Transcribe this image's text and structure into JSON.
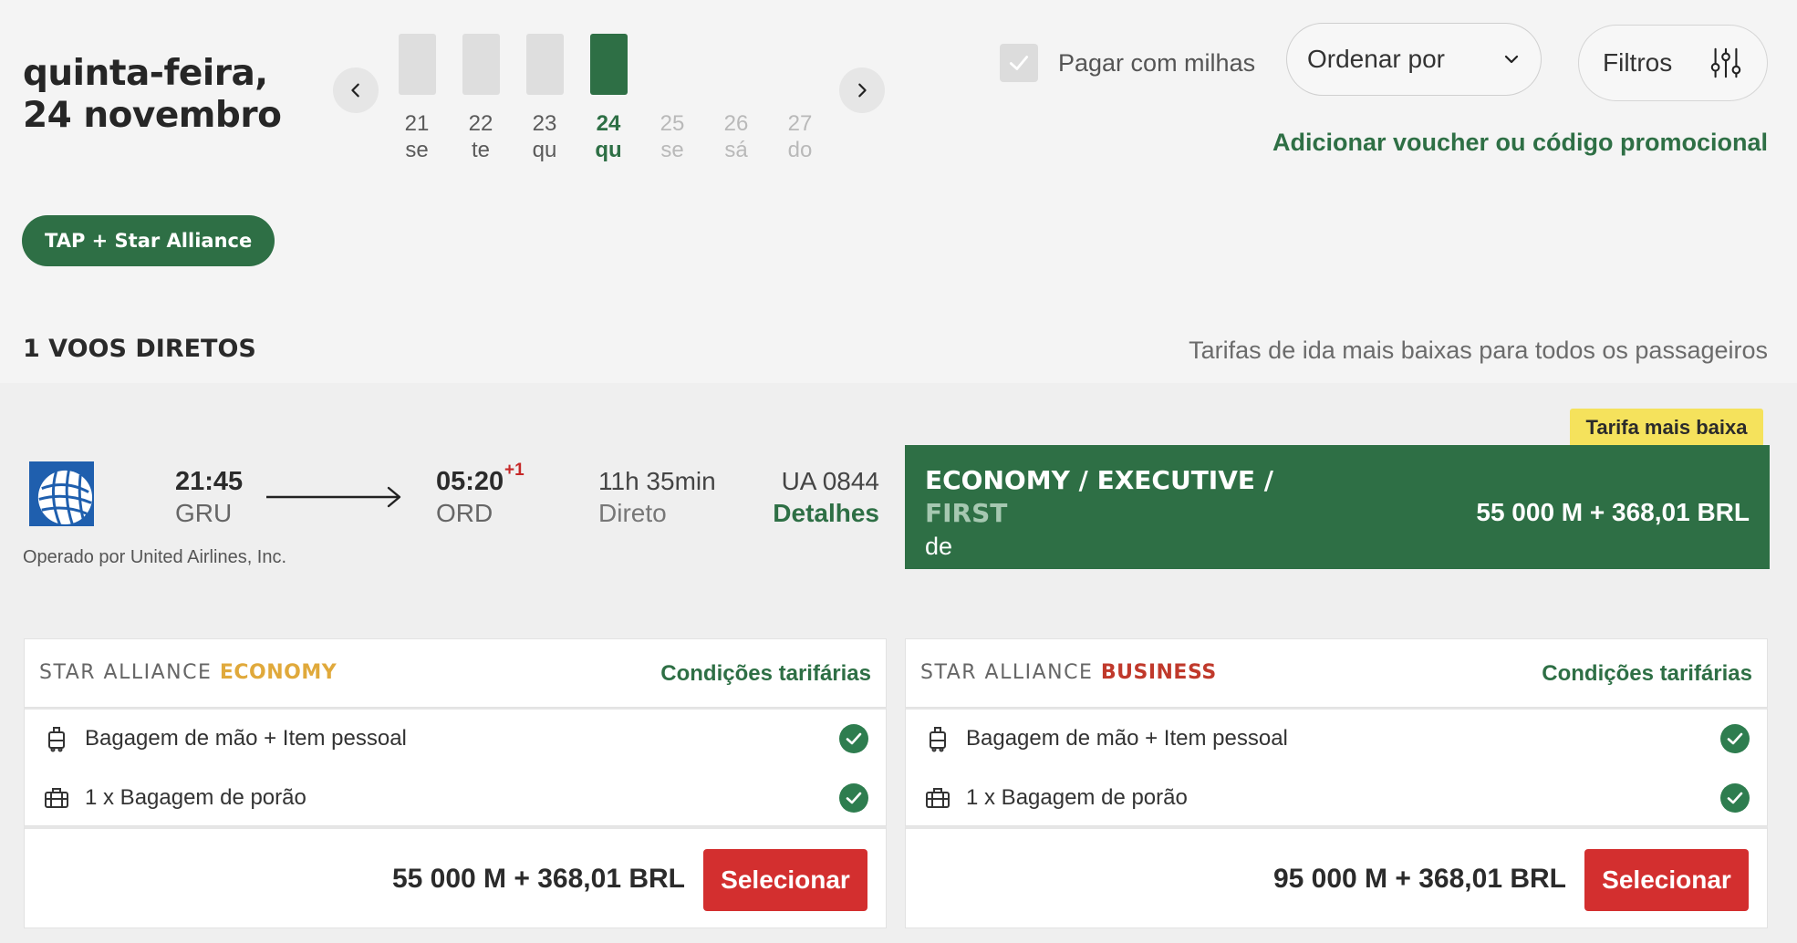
{
  "header": {
    "date_line1": "quinta-feira,",
    "date_line2": "24 novembro",
    "days": [
      {
        "num": "21",
        "wd": "se",
        "level": 0.75,
        "state": "normal"
      },
      {
        "num": "22",
        "wd": "te",
        "level": 0.75,
        "state": "normal"
      },
      {
        "num": "23",
        "wd": "qu",
        "level": 0.75,
        "state": "normal"
      },
      {
        "num": "24",
        "wd": "qu",
        "level": 0.75,
        "state": "selected"
      },
      {
        "num": "25",
        "wd": "se",
        "level": 0,
        "state": "disabled"
      },
      {
        "num": "26",
        "wd": "sá",
        "level": 0,
        "state": "disabled"
      },
      {
        "num": "27",
        "wd": "do",
        "level": 0,
        "state": "disabled"
      }
    ],
    "pay_with_miles_label": "Pagar com milhas",
    "pay_with_miles_checked": true,
    "sort_label": "Ordenar por",
    "filters_label": "Filtros",
    "voucher_link": "Adicionar voucher ou código promocional",
    "alliance_filter": "TAP + Star Alliance"
  },
  "results": {
    "count_label": "1 VOOS DIRETOS",
    "note": "Tarifas de ida mais baixas para todos os passageiros"
  },
  "flight": {
    "airline_logo_icon": "united-globe-icon",
    "departure_time": "21:45",
    "departure_airport": "GRU",
    "arrival_time": "05:20",
    "arrival_day_offset": "+1",
    "arrival_airport": "ORD",
    "duration": "11h 35min",
    "stops": "Direto",
    "flight_number": "UA 0844",
    "details_link": "Detalhes",
    "operated_by": "Operado por United Airlines, Inc.",
    "badge": "Tarifa mais baixa",
    "cabin_line1": "ECONOMY / EXECUTIVE /",
    "cabin_line2": "FIRST",
    "cabin_line3": "de",
    "cabin_price": "55 000 M + 368,01 BRL"
  },
  "fares": [
    {
      "brand_prefix": "STAR ALLIANCE",
      "brand_name": "ECONOMY",
      "brand_color": "#e0a93b",
      "conditions_link": "Condições tarifárias",
      "feature1": "Bagagem de mão + Item pessoal",
      "feature2": "1 x Bagagem de porão",
      "price": "55 000 M + 368,01 BRL",
      "select_label": "Selecionar"
    },
    {
      "brand_prefix": "STAR ALLIANCE",
      "brand_name": "BUSINESS",
      "brand_color": "#c0392b",
      "conditions_link": "Condições tarifárias",
      "feature1": "Bagagem de mão + Item pessoal",
      "feature2": "1 x Bagagem de porão",
      "price": "95 000 M + 368,01 BRL",
      "select_label": "Selecionar"
    }
  ],
  "colors": {
    "brand_green": "#2e6f45",
    "select_red": "#d32f2f",
    "badge_yellow": "#f5e25c"
  }
}
